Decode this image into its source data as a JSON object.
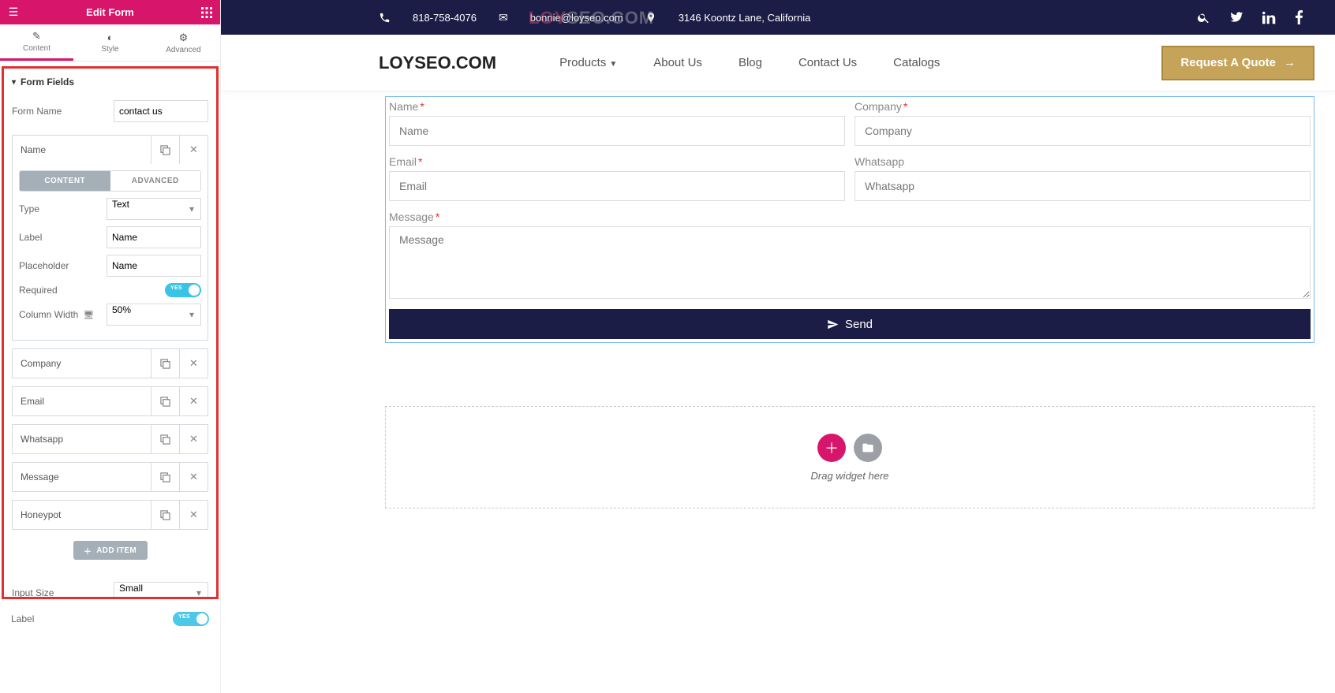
{
  "sidebar": {
    "title": "Edit Form",
    "tabs": {
      "content": "Content",
      "style": "Style",
      "advanced": "Advanced"
    },
    "section": "Form Fields",
    "form_name_label": "Form Name",
    "form_name_value": "contact us",
    "field_subtabs": {
      "content": "CONTENT",
      "advanced": "ADVANCED"
    },
    "name_field": {
      "head": "Name",
      "type_label": "Type",
      "type_value": "Text",
      "label_label": "Label",
      "label_value": "Name",
      "placeholder_label": "Placeholder",
      "placeholder_value": "Name",
      "required_label": "Required",
      "required_toggle_text": "YES",
      "colwidth_label": "Column Width",
      "colwidth_value": "50%"
    },
    "other_fields": {
      "company": "Company",
      "email": "Email",
      "whatsapp": "Whatsapp",
      "message": "Message",
      "honeypot": "Honeypot"
    },
    "add_item": "ADD ITEM",
    "input_size_label": "Input Size",
    "input_size_value": "Small",
    "below_label": "Label"
  },
  "topbar": {
    "phone": "818-758-4076",
    "email": "bonnie@loyseo.com",
    "address": "3146 Koontz Lane, California"
  },
  "watermark": {
    "a": "LOY",
    "b": "SEO.COM"
  },
  "navbar": {
    "brand": "LOYSEO.COM",
    "menu": {
      "products": "Products",
      "about": "About Us",
      "blog": "Blog",
      "contact": "Contact Us",
      "catalogs": "Catalogs"
    },
    "quote": "Request A Quote"
  },
  "form": {
    "name_label": "Name",
    "name_ph": "Name",
    "company_label": "Company",
    "company_ph": "Company",
    "email_label": "Email",
    "email_ph": "Email",
    "whatsapp_label": "Whatsapp",
    "whatsapp_ph": "Whatsapp",
    "message_label": "Message",
    "message_ph": "Message",
    "send": "Send"
  },
  "drop": {
    "text": "Drag widget here"
  }
}
